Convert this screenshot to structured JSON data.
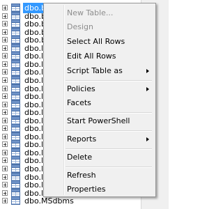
{
  "tree": {
    "rows": [
      {
        "label": "dbo.backupfile",
        "selected": true
      },
      {
        "label": "dbo.b",
        "selected": false
      },
      {
        "label": "dbo.b",
        "selected": false
      },
      {
        "label": "dbo.b",
        "selected": false
      },
      {
        "label": "dbo.b",
        "selected": false
      },
      {
        "label": "dbo.l",
        "selected": false
      },
      {
        "label": "dbo.l",
        "selected": false
      },
      {
        "label": "dbo.l",
        "selected": false
      },
      {
        "label": "dbo.l",
        "selected": false
      },
      {
        "label": "dbo.l",
        "selected": false
      },
      {
        "label": "dbo.l",
        "selected": false
      },
      {
        "label": "dbo.l",
        "selected": false
      },
      {
        "label": "dbo.l",
        "selected": false
      },
      {
        "label": "dbo.l",
        "selected": false
      },
      {
        "label": "dbo.l",
        "selected": false
      },
      {
        "label": "dbo.l",
        "selected": false
      },
      {
        "label": "dbo.l",
        "selected": false
      },
      {
        "label": "dbo.l",
        "selected": false
      },
      {
        "label": "dbo.l",
        "selected": false
      },
      {
        "label": "dbo.l",
        "selected": false
      },
      {
        "label": "dbo.l",
        "selected": false
      },
      {
        "label": "dbo.l",
        "selected": false
      },
      {
        "label": "dbo.l",
        "selected": false
      },
      {
        "label": "dbo.l",
        "selected": false
      },
      {
        "label": "dbo.MSdbms",
        "selected": false
      }
    ]
  },
  "context_menu": {
    "items": [
      {
        "label": "New Table...",
        "enabled": false,
        "submenu": false
      },
      {
        "label": "Design",
        "enabled": false,
        "submenu": false
      },
      {
        "label": "Select All Rows",
        "enabled": true,
        "submenu": false
      },
      {
        "label": "Edit All Rows",
        "enabled": true,
        "submenu": false
      },
      {
        "label": "Script Table as",
        "enabled": true,
        "submenu": true
      },
      {
        "label": "Policies",
        "enabled": true,
        "submenu": true
      },
      {
        "label": "Facets",
        "enabled": true,
        "submenu": false
      },
      {
        "label": "Start PowerShell",
        "enabled": true,
        "submenu": false
      },
      {
        "label": "Reports",
        "enabled": true,
        "submenu": true
      },
      {
        "label": "Delete",
        "enabled": true,
        "submenu": false
      },
      {
        "label": "Refresh",
        "enabled": true,
        "submenu": false
      },
      {
        "label": "Properties",
        "enabled": true,
        "submenu": false
      }
    ]
  }
}
